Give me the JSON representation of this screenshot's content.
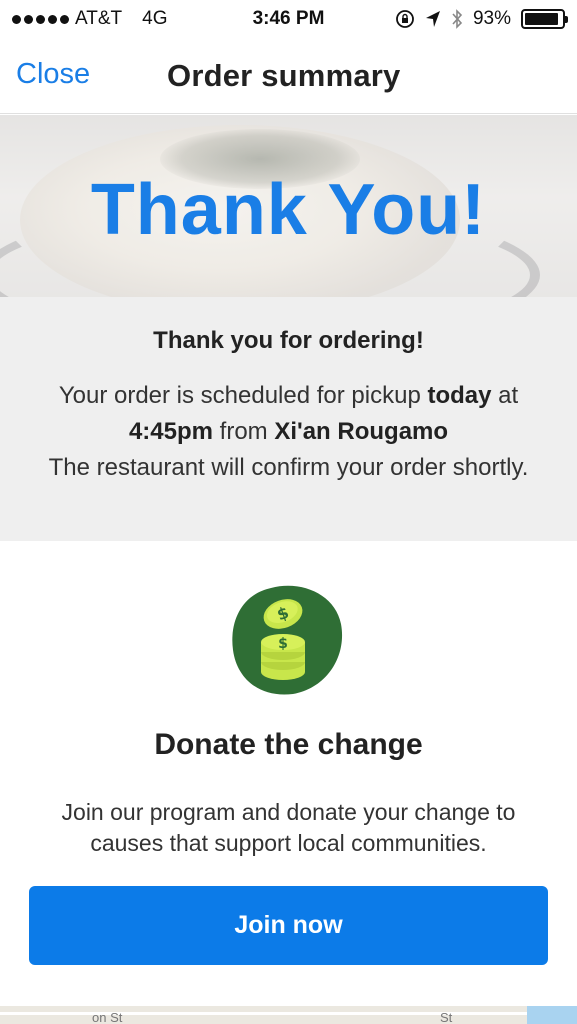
{
  "status_bar": {
    "carrier": "AT&T",
    "network": "4G",
    "time": "3:46 PM",
    "battery": "93%",
    "battery_level": 0.93,
    "icons": [
      "signal-dots-icon",
      "orientation-lock-icon",
      "location-arrow-icon",
      "bluetooth-icon",
      "battery-icon"
    ]
  },
  "nav": {
    "close_label": "Close",
    "title": "Order summary"
  },
  "hero": {
    "title": "Thank You!"
  },
  "info": {
    "heading": "Thank you for ordering!",
    "line1_prefix": "Your order is scheduled for pickup ",
    "day": "today",
    "line1_suffix": " at",
    "time": "4:45pm",
    "from_text": " from ",
    "restaurant": "Xi'an Rougamo",
    "confirm_text": "The restaurant will confirm your order shortly."
  },
  "donate": {
    "icon": "coins-icon",
    "title": "Donate the change",
    "description": "Join our program and donate your change to causes that support local communities.",
    "button_label": "Join now"
  },
  "map": {
    "street_label_1": "on St",
    "street_label_2": "St"
  },
  "colors": {
    "accent": "#1a7ee6",
    "button": "#0c7be8",
    "icon_bg": "#2f6e35",
    "icon_coin": "#c8e64b"
  }
}
